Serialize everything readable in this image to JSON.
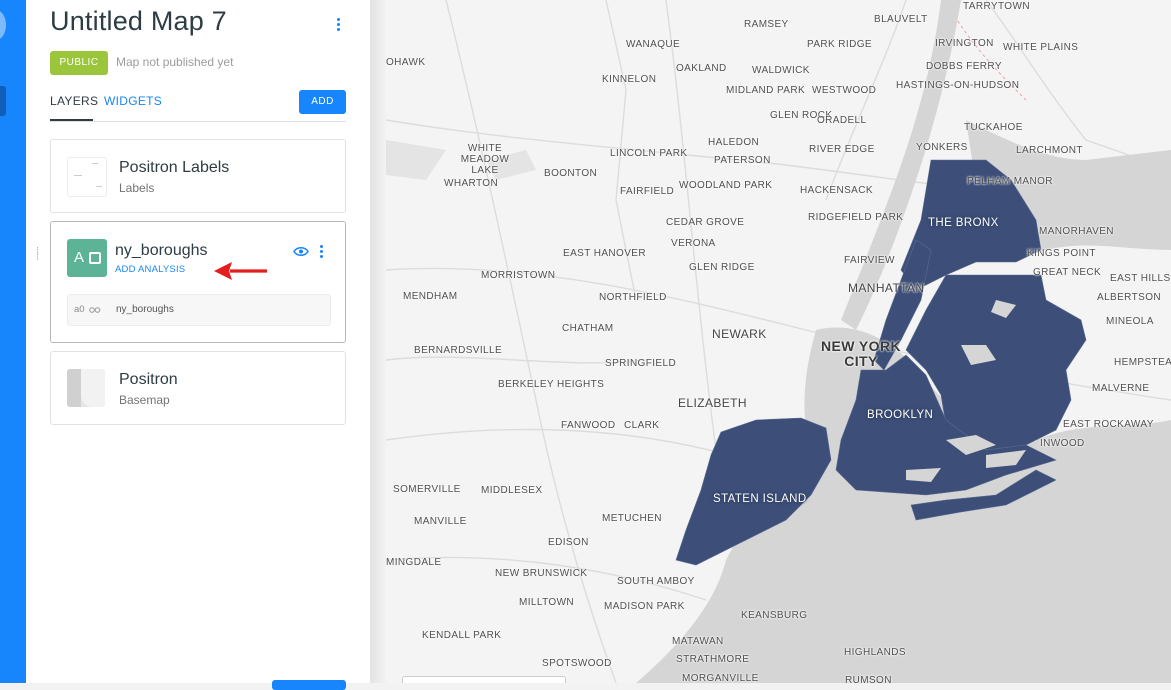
{
  "panel": {
    "title": "Untitled Map 7",
    "badge": "PUBLIC",
    "publish_status": "Map not published yet",
    "tabs": [
      {
        "label": "LAYERS",
        "active": true
      },
      {
        "label": "WIDGETS",
        "active": false
      }
    ],
    "add_label": "ADD"
  },
  "layers": [
    {
      "name": "Positron Labels",
      "subtitle": "Labels"
    },
    {
      "name": "ny_boroughs",
      "thumb_letter": "A",
      "action": "ADD ANALYSIS",
      "analysis_id": "a0",
      "analysis_name": "ny_boroughs"
    },
    {
      "name": "Positron",
      "subtitle": "Basemap"
    }
  ],
  "map": {
    "fill_color": "#3d4f79",
    "water_color": "#d5d5d5",
    "land_color": "#f4f4f4",
    "city_labels": [
      "TARRYTOWN",
      "RAMSEY",
      "BLAUVELT",
      "IRVINGTON",
      "WHITE PLAINS",
      "WANAQUE",
      "OAKLAND",
      "WALDWICK",
      "PARK RIDGE",
      "DOBBS FERRY",
      "OHAWK",
      "KINNELON",
      "MIDLAND PARK",
      "WESTWOOD",
      "HASTINGS-ON-HUDSON",
      "GLEN ROCK",
      "ORADELL",
      "TUCKAHOE",
      "HALEDON",
      "WHITE MEADOW LAKE",
      "LINCOLN PARK",
      "RIVER EDGE",
      "YONKERS",
      "LARCHMONT",
      "PATERSON",
      "BOONTON",
      "PELHAM MANOR",
      "WHARTON",
      "FAIRFIELD",
      "WOODLAND PARK",
      "HACKENSACK",
      "CEDAR GROVE",
      "RIDGEFIELD PARK",
      "MANORHAVEN",
      "VERONA",
      "EAST HANOVER",
      "KINGS POINT",
      "GLEN RIDGE",
      "FAIRVIEW",
      "MORRISTOWN",
      "GREAT NECK",
      "EAST HILLS",
      "MENDHAM",
      "NORTHFIELD",
      "ALBERTSON",
      "CHATHAM",
      "NEWARK",
      "MINEOLA",
      "BERNARDSVILLE",
      "SPRINGFIELD",
      "HEMPSTEAD",
      "BERKELEY HEIGHTS",
      "MALVERNE",
      "ELIZABETH",
      "FANWOOD",
      "CLARK",
      "EAST ROCKAWAY",
      "INWOOD",
      "SOMERVILLE",
      "MIDDLESEX",
      "MANVILLE",
      "METUCHEN",
      "EDISON",
      "MINGDALE",
      "NEW BRUNSWICK",
      "SOUTH AMBOY",
      "MILLTOWN",
      "MADISON PARK",
      "KEANSBURG",
      "KENDALL PARK",
      "MATAWAN",
      "SPOTSWOOD",
      "STRATHMORE",
      "HIGHLANDS",
      "MORGANVILLE",
      "RUMSON"
    ],
    "major_labels": [
      "MANHATTAN",
      "NEW YORK CITY"
    ],
    "borough_labels": [
      "THE BRONX",
      "BROOKLYN",
      "STATEN ISLAND"
    ]
  }
}
